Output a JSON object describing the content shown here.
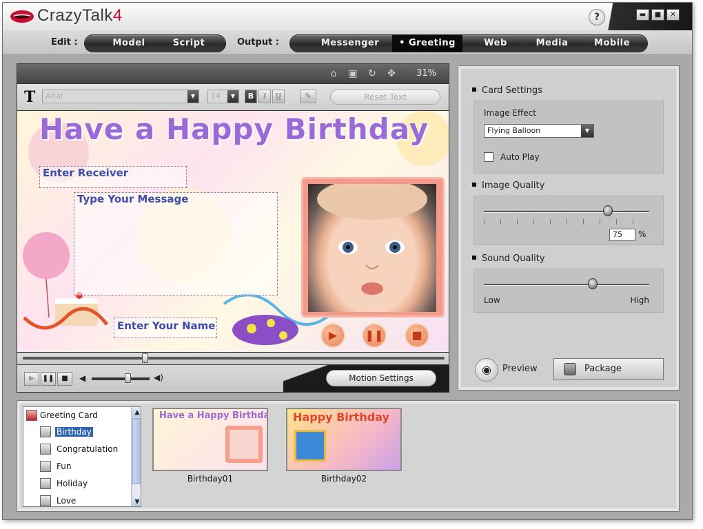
{
  "app": {
    "title": "CrazyTalk",
    "version": "4"
  },
  "window": {
    "help": "?",
    "minimize": "▬",
    "maximize": "■",
    "close": "✕"
  },
  "menu": {
    "edit_label": "Edit :",
    "edit_items": [
      "Model",
      "Script"
    ],
    "output_label": "Output :",
    "output_items": [
      "Messenger",
      "Greeting",
      "Web",
      "Media",
      "Mobile"
    ],
    "active_output": "Greeting",
    "active_marker": "•"
  },
  "viewer": {
    "zoom": "31%"
  },
  "fontbar": {
    "font_name": "Arial",
    "font_size": "14",
    "bold": "B",
    "italic": "I",
    "underline": "U",
    "reset_label": "Reset Text"
  },
  "card": {
    "title": "Have a Happy Birthday",
    "receiver_placeholder": "Enter Receiver",
    "message_placeholder": "Type Your Message",
    "name_placeholder": "Enter Your Name"
  },
  "playback": {
    "motion_settings_label": "Motion Settings",
    "timeline_position": 0.29,
    "volume_level": 0.62
  },
  "settings": {
    "card_settings_label": "Card Settings",
    "image_effect_label": "Image Effect",
    "image_effect_value": "Flying Balloon",
    "auto_play_label": "Auto Play",
    "auto_play_checked": false,
    "image_quality_label": "Image Quality",
    "image_quality_value": "75",
    "image_quality_unit": "%",
    "sound_quality_label": "Sound Quality",
    "sound_low": "Low",
    "sound_high": "High",
    "sound_quality_level": 0.66,
    "preview_label": "Preview",
    "package_label": "Package"
  },
  "library": {
    "root": "Greeting Card",
    "categories": [
      "Birthday",
      "Congratulation",
      "Fun",
      "Holiday",
      "Love"
    ],
    "selected_category": "Birthday",
    "templates": [
      {
        "name": "Birthday01",
        "preview_text": "Have a Happy Birthday"
      },
      {
        "name": "Birthday02",
        "preview_text": "Happy Birthday"
      }
    ]
  },
  "colors": {
    "accent": "#c8102e",
    "title_purple": "#9a6bd6",
    "field_blue": "#3b4da8",
    "selection": "#2f64b0"
  }
}
